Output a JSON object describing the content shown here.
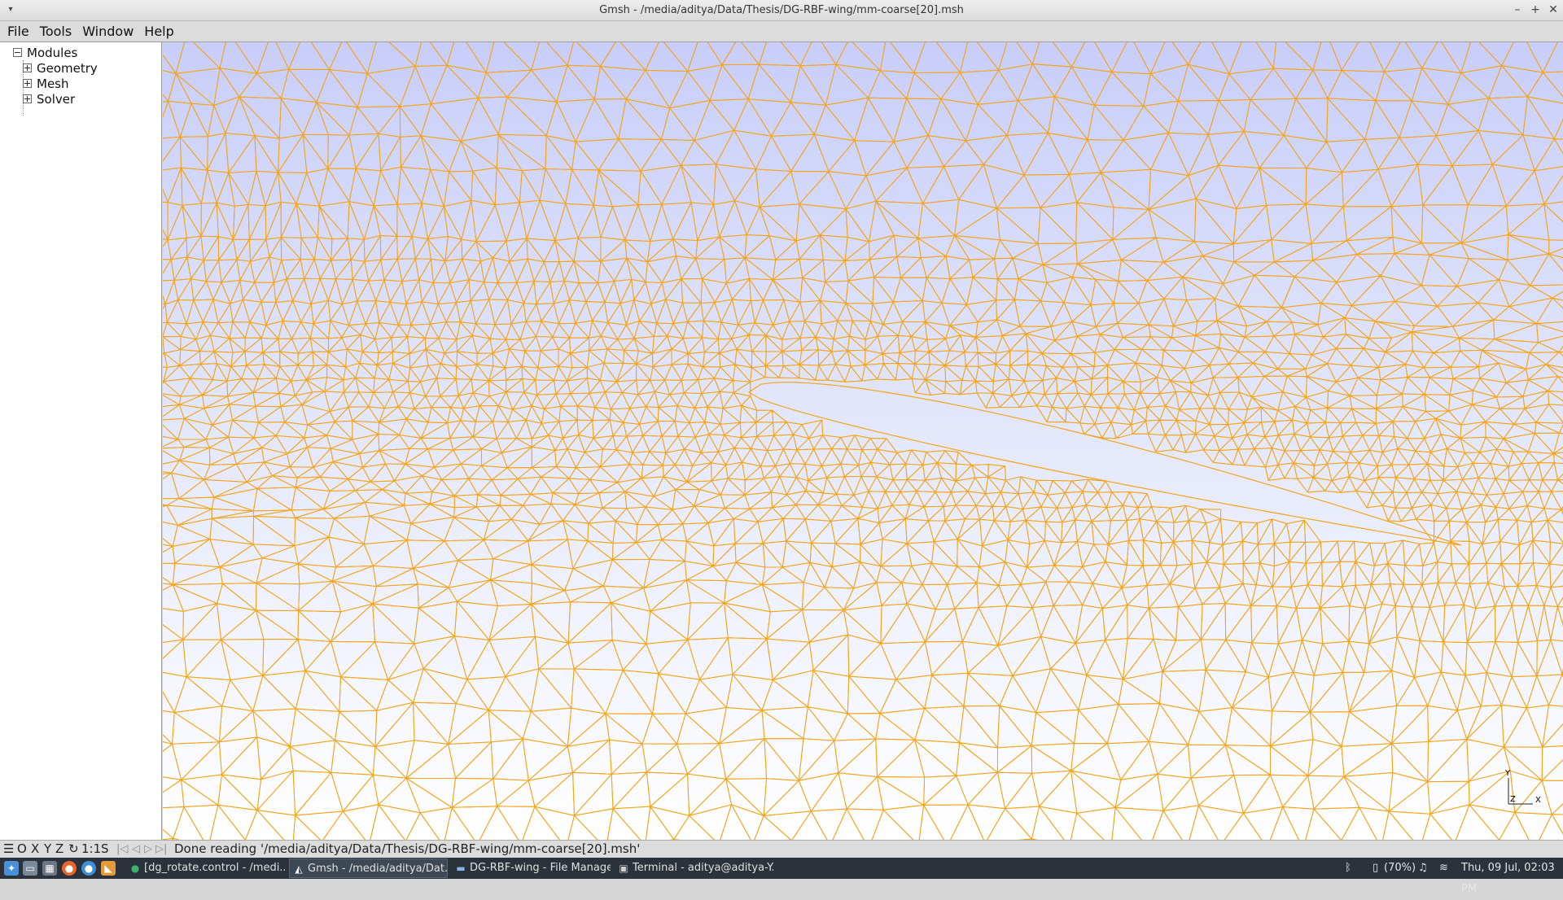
{
  "window": {
    "title": "Gmsh - /media/aditya/Data/Thesis/DG-RBF-wing/mm-coarse[20].msh",
    "menu_arrow": "▾",
    "minimize": "–",
    "maximize": "+",
    "close": "✕"
  },
  "menubar": {
    "file": "File",
    "tools": "Tools",
    "window": "Window",
    "help": "Help"
  },
  "tree": {
    "root": "Modules",
    "items": [
      "Geometry",
      "Mesh",
      "Solver"
    ]
  },
  "options_button": {
    "icon": "gear-icon",
    "glyph": "⚙",
    "dropdown": "▽"
  },
  "viewport": {
    "mesh_color": "#f5a31a",
    "background_top": "#c8cef9",
    "background_bottom": "#ffffff",
    "axes": {
      "x": "X",
      "y": "Y",
      "z": "Z"
    }
  },
  "statusbar": {
    "menu_glyph": "☰",
    "o": "O",
    "x": "X",
    "y": "Y",
    "z": "Z",
    "rotate_glyph": "↻",
    "scale": "1:1",
    "s": "S",
    "nav_first": "|◁",
    "nav_prev": "◁",
    "nav_next": "▷",
    "nav_last": "▷|",
    "message": "Done reading '/media/aditya/Data/Thesis/DG-RBF-wing/mm-coarse[20].msh'"
  },
  "taskbar": {
    "tasks": [
      "[dg_rotate.control - /medi...",
      "Gmsh - /media/aditya/Dat...",
      "DG-RBF-wing - File Manager",
      "Terminal - aditya@aditya-Y..."
    ],
    "battery": "(70%)",
    "clock": "Thu, 09 Jul, 02:03 PM"
  }
}
